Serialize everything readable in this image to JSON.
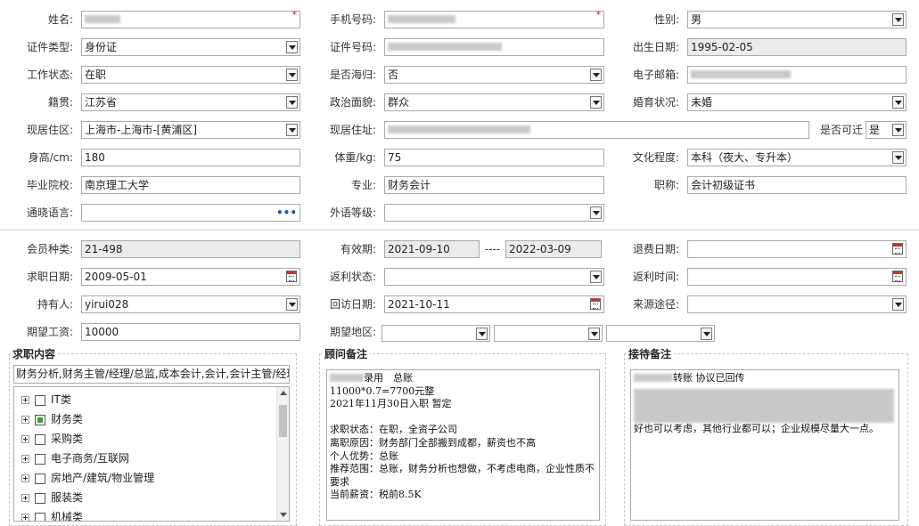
{
  "form": {
    "name": {
      "label": "姓名:"
    },
    "mobile": {
      "label": "手机号码:"
    },
    "gender": {
      "label": "性别:",
      "value": "男"
    },
    "id_type": {
      "label": "证件类型:",
      "value": "身份证"
    },
    "id_number": {
      "label": "证件号码:"
    },
    "birth_date": {
      "label": "出生日期:",
      "value": "1995-02-05"
    },
    "work_status": {
      "label": "工作状态:",
      "value": "在职"
    },
    "overseas_returnee": {
      "label": "是否海归:",
      "value": "否"
    },
    "email": {
      "label": "电子邮箱:"
    },
    "native_place": {
      "label": "籍贯:",
      "value": "江苏省"
    },
    "political_status": {
      "label": "政治面貌:",
      "value": "群众"
    },
    "marital_status": {
      "label": "婚育状况:",
      "value": "未婚"
    },
    "residence_area": {
      "label": "现居住区:",
      "value": "上海市-上海市-[黄浦区]"
    },
    "residence_address": {
      "label": "现居住址:"
    },
    "relocatable": {
      "label": "是否可迁",
      "value": "是"
    },
    "height": {
      "label": "身高/cm:",
      "value": "180"
    },
    "weight": {
      "label": "体重/kg:",
      "value": "75"
    },
    "education": {
      "label": "文化程度:",
      "value": "本科（夜大、专升本）"
    },
    "school": {
      "label": "毕业院校:",
      "value": "南京理工大学"
    },
    "major": {
      "label": "专业:",
      "value": "财务会计"
    },
    "title": {
      "label": "职称:",
      "value": "会计初级证书"
    },
    "language": {
      "label": "通晓语言:",
      "more": "•••"
    },
    "foreign_level": {
      "label": "外语等级:"
    },
    "member_type": {
      "label": "会员种类:",
      "value": "21-498"
    },
    "valid_period": {
      "label": "有效期:",
      "from": "2021-09-10",
      "sep": "----",
      "to": "2022-03-09"
    },
    "refund_date": {
      "label": "退费日期:"
    },
    "job_date": {
      "label": "求职日期:",
      "value": "2009-05-01"
    },
    "rebate_status": {
      "label": "返利状态:"
    },
    "rebate_time": {
      "label": "返利时间:"
    },
    "holder": {
      "label": "持有人:",
      "value": "yirui028"
    },
    "visit_date": {
      "label": "回访日期:",
      "value": "2021-10-11"
    },
    "source": {
      "label": "来源途径:"
    },
    "salary": {
      "label": "期望工资:",
      "value": "10000"
    },
    "region": {
      "label": "期望地区:"
    }
  },
  "job_content": {
    "title": "求职内容",
    "summary": "财务分析,财务主管/经理/总监,成本会计,会计,会计主管/经理",
    "categories": [
      {
        "label": "IT类",
        "checked": false
      },
      {
        "label": "财务类",
        "checked": true
      },
      {
        "label": "采购类",
        "checked": false
      },
      {
        "label": "电子商务/互联网",
        "checked": false
      },
      {
        "label": "房地产/建筑/物业管理",
        "checked": false
      },
      {
        "label": "服装类",
        "checked": false
      },
      {
        "label": "机械类",
        "checked": false
      }
    ]
  },
  "consultant_notes": {
    "title": "顾问备注",
    "line1_suffix": "录用　总账",
    "body": "11000*0.7=7700元整\n2021年11月30日入职 暂定\n\n求职状态：在职，全资子公司\n离职原因：财务部门全部搬到成都，薪资也不高\n个人优势：总账\n推荐范围：总账，财务分析也想做，不考虑电商，企业性质不要求\n当前薪资：税前8.5K"
  },
  "reception_notes": {
    "title": "接待备注",
    "line1_suffix": "转账 协议已回传",
    "body": "好也可以考虑，其他行业都可以；企业规模尽量大一点。"
  }
}
